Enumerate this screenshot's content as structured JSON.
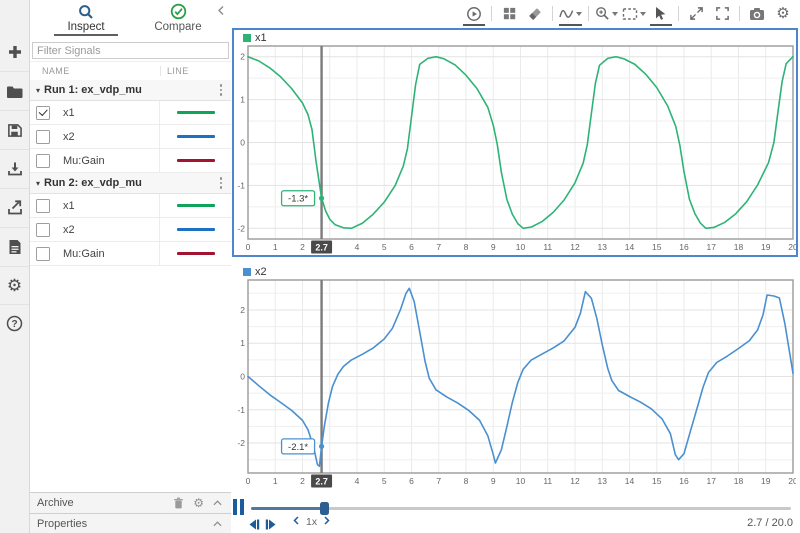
{
  "sidebar": {
    "tabs": [
      {
        "label": "Inspect",
        "icon": "search-icon",
        "active": true
      },
      {
        "label": "Compare",
        "icon": "check-circle-icon",
        "active": false
      }
    ],
    "collapse_icon": "chevron-left-icon",
    "filter_placeholder": "Filter Signals",
    "columns": {
      "name": "NAME",
      "line": "LINE"
    },
    "runs": [
      {
        "label": "Run 1: ex_vdp_mu",
        "signals": [
          {
            "name": "x1",
            "checked": true,
            "color": "#0fa45a"
          },
          {
            "name": "x2",
            "checked": false,
            "color": "#1d70c2"
          },
          {
            "name": "Mu:Gain",
            "checked": false,
            "color": "#a2142f"
          }
        ]
      },
      {
        "label": "Run 2: ex_vdp_mu",
        "signals": [
          {
            "name": "x1",
            "checked": false,
            "color": "#0fa45a"
          },
          {
            "name": "x2",
            "checked": false,
            "color": "#1d70c2"
          },
          {
            "name": "Mu:Gain",
            "checked": false,
            "color": "#a2142f"
          }
        ]
      }
    ],
    "archive_label": "Archive",
    "properties_label": "Properties"
  },
  "toolstrip_icons": [
    "plus-icon",
    "folder-icon",
    "save-icon",
    "import-icon",
    "export-icon",
    "report-icon",
    "gear-icon",
    "help-icon"
  ],
  "toolbar_icons": [
    "record-icon",
    "layout-grid-icon",
    "eraser-icon",
    "signal-wave-icon",
    "zoom-in-icon",
    "fit-to-view-icon",
    "arrow-cursor-icon",
    "expand-icon",
    "fullscreen-icon",
    "camera-icon",
    "gear-icon"
  ],
  "cursor": {
    "time_label": "2.7",
    "time": 2.7
  },
  "transport": {
    "speed_label": "1x",
    "time_readout": "2.7 / 20.0",
    "progress_pct": 13.5
  },
  "colors": {
    "selection_border": "#4d86cc",
    "cursor_line": "#7b7b7b",
    "cursor_flag_bg": "#4a4a4a"
  },
  "chart_data": [
    {
      "type": "line",
      "title": "x1",
      "color": "#2eb377",
      "xlabel": "",
      "ylabel": "",
      "x_range": [
        0,
        20
      ],
      "y_range": [
        -2.25,
        2.25
      ],
      "x_ticks": "integers 0-20",
      "y_ticks": [
        -2,
        -1,
        0,
        1,
        2
      ],
      "grid": true,
      "legend_position": "top-left",
      "cursor_label": "-1.3*",
      "cursor_value": -1.3,
      "points": [
        [
          0,
          2
        ],
        [
          0.4,
          1.9
        ],
        [
          0.8,
          1.74
        ],
        [
          1.2,
          1.53
        ],
        [
          1.6,
          1.26
        ],
        [
          2,
          0.92
        ],
        [
          2.2,
          0.65
        ],
        [
          2.35,
          0.3
        ],
        [
          2.5,
          -0.45
        ],
        [
          2.7,
          -1.3
        ],
        [
          2.85,
          -1.6
        ],
        [
          3,
          -1.79
        ],
        [
          3.2,
          -1.92
        ],
        [
          3.5,
          -1.99
        ],
        [
          3.8,
          -2
        ],
        [
          4.2,
          -1.88
        ],
        [
          4.6,
          -1.67
        ],
        [
          5,
          -1.39
        ],
        [
          5.4,
          -1
        ],
        [
          5.7,
          -0.55
        ],
        [
          5.85,
          -0.15
        ],
        [
          6,
          0.6
        ],
        [
          6.15,
          1.35
        ],
        [
          6.3,
          1.82
        ],
        [
          6.6,
          1.96
        ],
        [
          6.9,
          2
        ],
        [
          7.2,
          1.95
        ],
        [
          7.6,
          1.81
        ],
        [
          8,
          1.57
        ],
        [
          8.4,
          1.26
        ],
        [
          8.8,
          0.82
        ],
        [
          9,
          0.4
        ],
        [
          9.15,
          -0.05
        ],
        [
          9.3,
          -0.7
        ],
        [
          9.5,
          -1.33
        ],
        [
          9.7,
          -1.67
        ],
        [
          9.9,
          -1.89
        ],
        [
          10.1,
          -2
        ],
        [
          10.4,
          -1.97
        ],
        [
          10.8,
          -1.84
        ],
        [
          11.2,
          -1.63
        ],
        [
          11.6,
          -1.34
        ],
        [
          12,
          -0.94
        ],
        [
          12.3,
          -0.48
        ],
        [
          12.45,
          -0.05
        ],
        [
          12.6,
          0.68
        ],
        [
          12.75,
          1.38
        ],
        [
          12.9,
          1.8
        ],
        [
          13.2,
          1.96
        ],
        [
          13.5,
          2
        ],
        [
          13.8,
          1.95
        ],
        [
          14.2,
          1.82
        ],
        [
          14.6,
          1.59
        ],
        [
          15,
          1.28
        ],
        [
          15.4,
          0.85
        ],
        [
          15.7,
          0.37
        ],
        [
          15.85,
          -0.07
        ],
        [
          16,
          -0.68
        ],
        [
          16.2,
          -1.32
        ],
        [
          16.4,
          -1.66
        ],
        [
          16.6,
          -1.88
        ],
        [
          16.8,
          -2
        ],
        [
          17.1,
          -1.98
        ],
        [
          17.5,
          -1.86
        ],
        [
          17.9,
          -1.66
        ],
        [
          18.3,
          -1.38
        ],
        [
          18.7,
          -0.99
        ],
        [
          19.1,
          -0.47
        ],
        [
          19.3,
          0
        ],
        [
          19.45,
          0.72
        ],
        [
          19.6,
          1.42
        ],
        [
          19.75,
          1.84
        ],
        [
          20,
          2
        ]
      ]
    },
    {
      "type": "line",
      "title": "x2",
      "color": "#4a90d0",
      "xlabel": "",
      "ylabel": "",
      "x_range": [
        0,
        20
      ],
      "y_range": [
        -2.9,
        2.9
      ],
      "x_ticks": "integers 0-20",
      "y_ticks": [
        -2,
        -1,
        0,
        1,
        2
      ],
      "grid": true,
      "legend_position": "top-left",
      "cursor_label": "-2.1*",
      "cursor_value": -2.1,
      "points": [
        [
          0,
          0
        ],
        [
          0.4,
          -0.28
        ],
        [
          0.8,
          -0.55
        ],
        [
          1.2,
          -0.78
        ],
        [
          1.6,
          -1.02
        ],
        [
          2,
          -1.32
        ],
        [
          2.2,
          -1.6
        ],
        [
          2.4,
          -2.1
        ],
        [
          2.55,
          -2.65
        ],
        [
          2.62,
          -2.7
        ],
        [
          2.7,
          -2.1
        ],
        [
          2.8,
          -1.5
        ],
        [
          2.95,
          -0.8
        ],
        [
          3.1,
          -0.3
        ],
        [
          3.3,
          0.07
        ],
        [
          3.5,
          0.3
        ],
        [
          3.8,
          0.5
        ],
        [
          4.2,
          0.67
        ],
        [
          4.6,
          0.86
        ],
        [
          5,
          1.13
        ],
        [
          5.3,
          1.45
        ],
        [
          5.6,
          2.02
        ],
        [
          5.8,
          2.5
        ],
        [
          5.92,
          2.65
        ],
        [
          6.1,
          2.25
        ],
        [
          6.3,
          1.35
        ],
        [
          6.5,
          0.45
        ],
        [
          6.65,
          -0.05
        ],
        [
          6.9,
          -0.4
        ],
        [
          7.3,
          -0.62
        ],
        [
          7.7,
          -0.8
        ],
        [
          8.1,
          -1.02
        ],
        [
          8.5,
          -1.32
        ],
        [
          8.8,
          -1.78
        ],
        [
          9,
          -2.35
        ],
        [
          9.08,
          -2.6
        ],
        [
          9.3,
          -2.2
        ],
        [
          9.5,
          -1.5
        ],
        [
          9.7,
          -0.78
        ],
        [
          9.9,
          -0.18
        ],
        [
          10.1,
          0.22
        ],
        [
          10.4,
          0.5
        ],
        [
          10.8,
          0.68
        ],
        [
          11.2,
          0.86
        ],
        [
          11.6,
          1.07
        ],
        [
          12,
          1.48
        ],
        [
          12.2,
          1.9
        ],
        [
          12.38,
          2.55
        ],
        [
          12.6,
          2.35
        ],
        [
          12.8,
          1.75
        ],
        [
          13,
          0.95
        ],
        [
          13.2,
          0.25
        ],
        [
          13.35,
          -0.12
        ],
        [
          13.6,
          -0.42
        ],
        [
          14,
          -0.6
        ],
        [
          14.4,
          -0.77
        ],
        [
          14.8,
          -0.97
        ],
        [
          15.2,
          -1.28
        ],
        [
          15.5,
          -1.72
        ],
        [
          15.68,
          -2.35
        ],
        [
          15.8,
          -2.5
        ],
        [
          16,
          -2.32
        ],
        [
          16.2,
          -1.75
        ],
        [
          16.5,
          -0.9
        ],
        [
          16.7,
          -0.32
        ],
        [
          16.9,
          0.12
        ],
        [
          17.2,
          0.42
        ],
        [
          17.6,
          0.62
        ],
        [
          18,
          0.84
        ],
        [
          18.4,
          1.08
        ],
        [
          18.7,
          1.4
        ],
        [
          18.9,
          1.85
        ],
        [
          19.05,
          2.45
        ],
        [
          19.3,
          2.42
        ],
        [
          19.5,
          2.36
        ],
        [
          19.7,
          1.6
        ],
        [
          19.85,
          0.85
        ],
        [
          20,
          0.1
        ]
      ]
    }
  ]
}
